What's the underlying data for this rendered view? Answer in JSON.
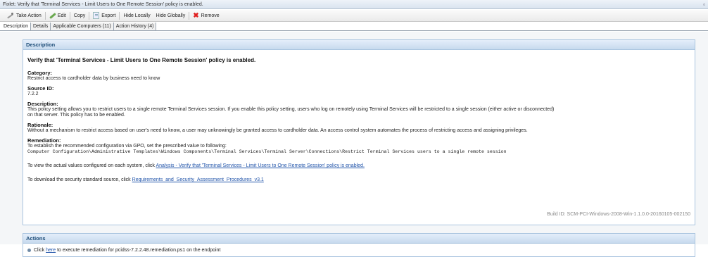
{
  "window": {
    "title": "Fixlet: Verify that 'Terminal Services - Limit Users to One Remote Session' policy is enabled.",
    "restore_glyph": "▫"
  },
  "toolbar": {
    "take_action": "Take Action",
    "edit": "Edit",
    "copy": "Copy",
    "export": "Export",
    "hide_locally": "Hide Locally",
    "hide_globally": "Hide Globally",
    "remove": "Remove"
  },
  "tabs": [
    {
      "label": "Description",
      "active": true
    },
    {
      "label": "Details",
      "active": false
    },
    {
      "label": "Applicable Computers (11)",
      "active": false
    },
    {
      "label": "Action History (4)",
      "active": false
    }
  ],
  "description": {
    "header": "Description",
    "heading": "Verify that 'Terminal Services - Limit Users to One Remote Session' policy is enabled.",
    "category_label": "Category:",
    "category_value": "Restrict access to cardholder data by business need to know",
    "source_label": "Source ID:",
    "source_value": "7.2.2",
    "desc_label": "Description:",
    "desc_line1": "This policy setting allows you to restrict users to a single remote Terminal Services session. If you enable this policy setting, users who log on remotely using Terminal Services will be restricted to a single session (either active or disconnected)",
    "desc_line2": "on that server. This policy has to be enabled.",
    "rationale_label": "Rationale:",
    "rationale_value": "Without a mechanism to restrict access based on user's need to know, a user may unknowingly be granted access to cardholder data. An access control system automates the process of restricting access and assigning privileges.",
    "remediation_label": "Remediation:",
    "remediation_line1": "To establish the recommended configuration via GPO, set the prescribed value to following:",
    "remediation_path": "Computer Configuration\\Administrative Templates\\Windows Components\\Terminal Services\\Terminal Server\\Connections\\Restrict Terminal Services users to a single remote session",
    "view_prefix": "To view the actual values configured on each system, click ",
    "view_link": "Analysis - Verify that 'Terminal Services - Limit Users to One Remote Session' policy is enabled.",
    "download_prefix": "To download the security standard source, click ",
    "download_link": "Requirements_and_Security_Assessment_Procedures_v3.1",
    "build_id": "Build ID: SCM-PCI-Windows-2008-Win-1.1.0.0-20160105-002150"
  },
  "actions": {
    "header": "Actions",
    "prefix": "Click ",
    "link": "here",
    "suffix": " to execute remediation for pcidss-7.2.2.48.remediation.ps1 on the endpoint"
  }
}
